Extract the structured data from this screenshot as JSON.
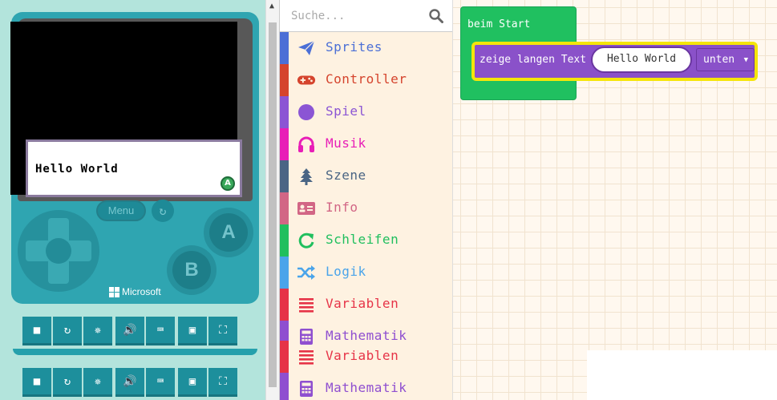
{
  "simulator": {
    "dialog_text": "Hello World",
    "a_hint": "A",
    "menu_label": "Menu",
    "button_a": "A",
    "button_b": "B",
    "brand": "Microsoft",
    "toolbar_icons": [
      "stop-icon",
      "restart-icon",
      "debug-icon",
      "sound-icon",
      "keyboard-icon",
      "screenshot-icon",
      "fullscreen-icon"
    ]
  },
  "toolbox": {
    "search_placeholder": "Suche...",
    "categories": [
      {
        "label": "Sprites",
        "color": "#4b6fd6",
        "icon": "paper-plane-icon"
      },
      {
        "label": "Controller",
        "color": "#d5442d",
        "icon": "gamepad-icon"
      },
      {
        "label": "Spiel",
        "color": "#8b55d4",
        "icon": "circle-icon"
      },
      {
        "label": "Musik",
        "color": "#e81eb7",
        "icon": "headphones-icon"
      },
      {
        "label": "Szene",
        "color": "#4a6584",
        "icon": "tree-icon"
      },
      {
        "label": "Info",
        "color": "#d26685",
        "icon": "id-card-icon"
      },
      {
        "label": "Schleifen",
        "color": "#20bf5e",
        "icon": "loop-icon"
      },
      {
        "label": "Logik",
        "color": "#4aa4ea",
        "icon": "shuffle-icon"
      },
      {
        "label": "Variablen",
        "color": "#e63347",
        "icon": "list-icon"
      },
      {
        "label": "Mathematik",
        "color": "#8f4fd0",
        "icon": "calculator-icon"
      },
      {
        "label": "Variablen",
        "color": "#e63347",
        "icon": "list-icon"
      },
      {
        "label": "Mathematik",
        "color": "#8f4fd0",
        "icon": "calculator-icon"
      }
    ]
  },
  "workspace": {
    "on_start_label": "beim Start",
    "say_label": "zeige langen Text",
    "say_text": "Hello World",
    "say_position": "unten"
  }
}
